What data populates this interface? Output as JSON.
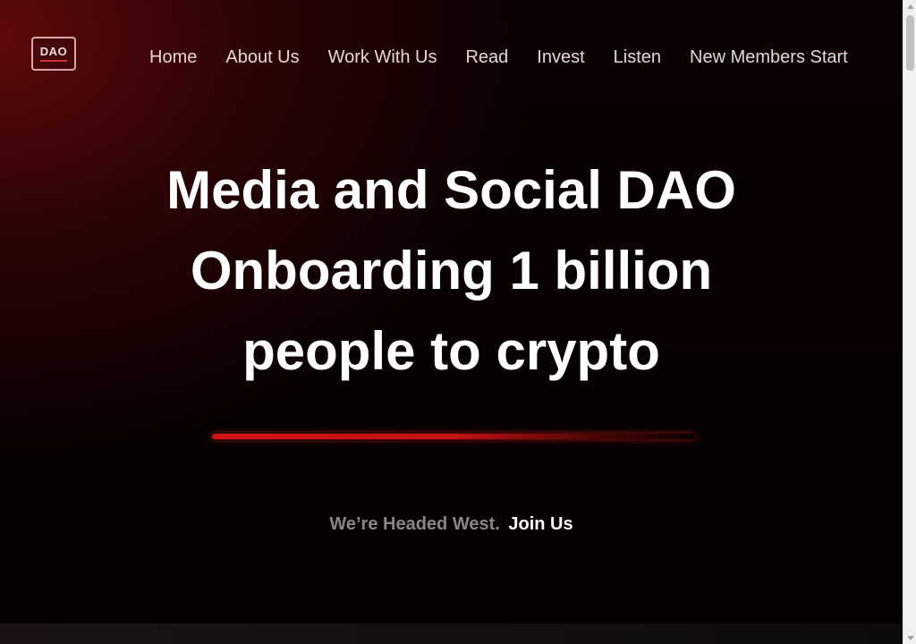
{
  "logo": {
    "text": "DAO"
  },
  "nav": {
    "items": [
      {
        "label": "Home"
      },
      {
        "label": "About Us"
      },
      {
        "label": "Work With Us"
      },
      {
        "label": "Read"
      },
      {
        "label": "Invest"
      },
      {
        "label": "Listen"
      },
      {
        "label": "New Members Start"
      }
    ]
  },
  "hero": {
    "title_lines": [
      "Media and Social DAO",
      "Onboarding 1 billion",
      "people to crypto"
    ]
  },
  "tagline": {
    "text": "We’re Headed West.",
    "link": "Join Us"
  },
  "colors": {
    "background": "#000000",
    "accent_red": "#d01515",
    "nav_text": "#ead6d6",
    "muted_text": "#8c8585"
  },
  "scrollbar": {
    "position_fraction": 0.0
  }
}
